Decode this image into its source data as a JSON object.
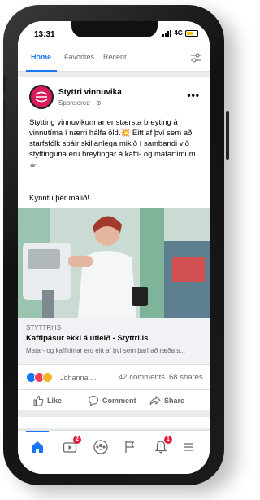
{
  "status_bar": {
    "time": "13:31",
    "network": "4G"
  },
  "top_nav": {
    "tabs": [
      "Home",
      "Favorites",
      "Recent"
    ]
  },
  "post": {
    "page_name": "Styttri vinnuvika",
    "sponsored_label": "Sponsored ·",
    "body": "Stytting vinnuvikunnar er stærsta breyting á vinnutíma í nærri hálfa öld.💥 Eitt af því sem að starfsfólk spáir skiljanlega mikið í sambandi við styttinguna eru breytingar á kaffi- og matartímum. ☕",
    "body_2": "Kynntu þér málið!",
    "link": {
      "domain": "STYTTRI.IS",
      "title": "Kaffipásur ekki á útleið - Styttri.is",
      "description": "Matar- og kaffitímar eru eitt af því sem þarf að ræða s..."
    },
    "reactions": {
      "names": "Johanna ...",
      "comments": "42 comments",
      "shares": "68 shares"
    },
    "actions": {
      "like": "Like",
      "comment": "Comment",
      "share": "Share"
    }
  },
  "bottom_nav": {
    "video_badge": "2",
    "notifications_badge": "1"
  },
  "colors": {
    "accent": "#1877f2",
    "badge": "#e41e3f",
    "avatar": "#d61a5c"
  }
}
